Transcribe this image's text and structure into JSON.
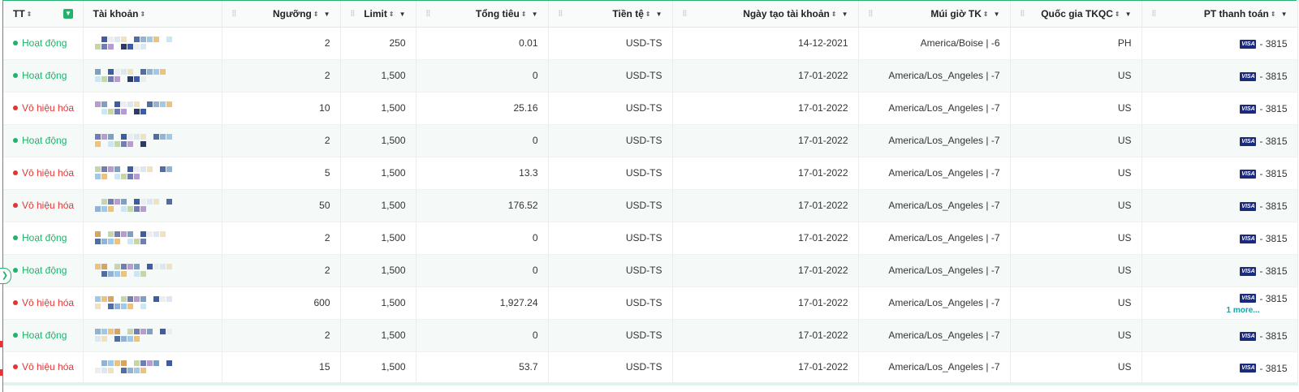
{
  "header": {
    "status": "TT",
    "account": "Tài khoản",
    "threshold": "Ngưỡng",
    "limit": "Limit",
    "total_spend": "Tổng tiêu",
    "currency": "Tiền tệ",
    "created": "Ngày tạo tài khoản",
    "timezone": "Múi giờ TK",
    "country": "Quốc gia TKQC",
    "payment": "PT thanh toán"
  },
  "icons": {
    "sort": "sort-icon",
    "filter": "filter-icon",
    "drag": "drag-handle-icon",
    "dropdown": "chevron-down-icon",
    "card": "visa-icon"
  },
  "colors": {
    "accent": "#22b26b",
    "active": "#22b26b",
    "disabled": "#e23636",
    "visa": "#1a2a7d"
  },
  "payment": {
    "brand": "VISA",
    "more_label": "1 more..."
  },
  "rows": [
    {
      "status": "Hoạt động",
      "active": true,
      "threshold": "2",
      "limit": "250",
      "spend": "0.01",
      "currency": "USD-TS",
      "created": "14-12-2021",
      "timezone": "America/Boise | -6",
      "country": "PH",
      "card": "- 3815",
      "more": false
    },
    {
      "status": "Hoạt động",
      "active": true,
      "threshold": "2",
      "limit": "1,500",
      "spend": "0",
      "currency": "USD-TS",
      "created": "17-01-2022",
      "timezone": "America/Los_Angeles | -7",
      "country": "US",
      "card": "- 3815",
      "more": false
    },
    {
      "status": "Vô hiệu hóa",
      "active": false,
      "threshold": "10",
      "limit": "1,500",
      "spend": "25.16",
      "currency": "USD-TS",
      "created": "17-01-2022",
      "timezone": "America/Los_Angeles | -7",
      "country": "US",
      "card": "- 3815",
      "more": false
    },
    {
      "status": "Hoạt động",
      "active": true,
      "threshold": "2",
      "limit": "1,500",
      "spend": "0",
      "currency": "USD-TS",
      "created": "17-01-2022",
      "timezone": "America/Los_Angeles | -7",
      "country": "US",
      "card": "- 3815",
      "more": false
    },
    {
      "status": "Vô hiệu hóa",
      "active": false,
      "threshold": "5",
      "limit": "1,500",
      "spend": "13.3",
      "currency": "USD-TS",
      "created": "17-01-2022",
      "timezone": "America/Los_Angeles | -7",
      "country": "US",
      "card": "- 3815",
      "more": false
    },
    {
      "status": "Vô hiệu hóa",
      "active": false,
      "threshold": "50",
      "limit": "1,500",
      "spend": "176.52",
      "currency": "USD-TS",
      "created": "17-01-2022",
      "timezone": "America/Los_Angeles | -7",
      "country": "US",
      "card": "- 3815",
      "more": false
    },
    {
      "status": "Hoạt động",
      "active": true,
      "threshold": "2",
      "limit": "1,500",
      "spend": "0",
      "currency": "USD-TS",
      "created": "17-01-2022",
      "timezone": "America/Los_Angeles | -7",
      "country": "US",
      "card": "- 3815",
      "more": false
    },
    {
      "status": "Hoạt động",
      "active": true,
      "threshold": "2",
      "limit": "1,500",
      "spend": "0",
      "currency": "USD-TS",
      "created": "17-01-2022",
      "timezone": "America/Los_Angeles | -7",
      "country": "US",
      "card": "- 3815",
      "more": false
    },
    {
      "status": "Vô hiệu hóa",
      "active": false,
      "threshold": "600",
      "limit": "1,500",
      "spend": "1,927.24",
      "currency": "USD-TS",
      "created": "17-01-2022",
      "timezone": "America/Los_Angeles | -7",
      "country": "US",
      "card": "- 3815",
      "more": true
    },
    {
      "status": "Hoạt động",
      "active": true,
      "threshold": "2",
      "limit": "1,500",
      "spend": "0",
      "currency": "USD-TS",
      "created": "17-01-2022",
      "timezone": "America/Los_Angeles | -7",
      "country": "US",
      "card": "- 3815",
      "more": false
    },
    {
      "status": "Vô hiệu hóa",
      "active": false,
      "threshold": "15",
      "limit": "1,500",
      "spend": "53.7",
      "currency": "USD-TS",
      "created": "17-01-2022",
      "timezone": "America/Los_Angeles | -7",
      "country": "US",
      "card": "- 3815",
      "more": false
    }
  ]
}
